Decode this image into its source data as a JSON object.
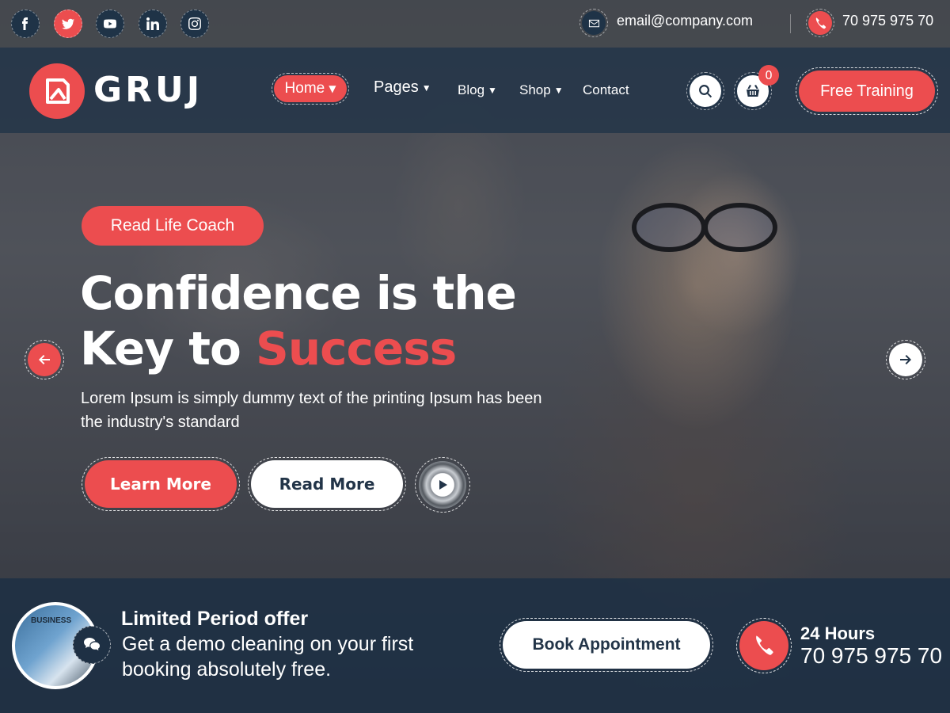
{
  "colors": {
    "accent": "#ec4d4f",
    "navy": "#223448",
    "white": "#ffffff"
  },
  "topbar": {
    "social": [
      {
        "name": "facebook-icon",
        "glyph": "f"
      },
      {
        "name": "twitter-icon",
        "glyph": "twitter"
      },
      {
        "name": "youtube-icon",
        "glyph": "youtube"
      },
      {
        "name": "linkedin-icon",
        "glyph": "in"
      },
      {
        "name": "instagram-icon",
        "glyph": "instagram"
      }
    ],
    "email": "email@company.com",
    "phone": "70 975 975 70"
  },
  "nav": {
    "logo_text": "GRUJ",
    "items": [
      {
        "label": "Home",
        "active": true,
        "has_dropdown": true
      },
      {
        "label": "Pages",
        "active": false,
        "has_dropdown": true
      },
      {
        "label": "Blog",
        "active": false,
        "has_dropdown": true
      },
      {
        "label": "Shop",
        "active": false,
        "has_dropdown": true
      },
      {
        "label": "Contact",
        "active": false,
        "has_dropdown": false
      }
    ],
    "cart_count": "0",
    "cta_label": "Free Training"
  },
  "hero": {
    "tagline": "Read Life Coach",
    "headline_line1": "Confidence is the",
    "headline_line2_prefix": "Key to",
    "headline_line2_accent": "Success",
    "subtext": "Lorem Ipsum is simply dummy text of the printing Ipsum has been the industry's standard",
    "primary_button": "Learn More",
    "secondary_button": "Read More"
  },
  "offer": {
    "thumb_label": "BUSINESS",
    "title": "Limited Period offer",
    "text": "Get a demo cleaning on your first booking absolutely free.",
    "book_button": "Book Appointment",
    "hours_label": "24 Hours",
    "hours_phone": "70 975 975 70"
  }
}
